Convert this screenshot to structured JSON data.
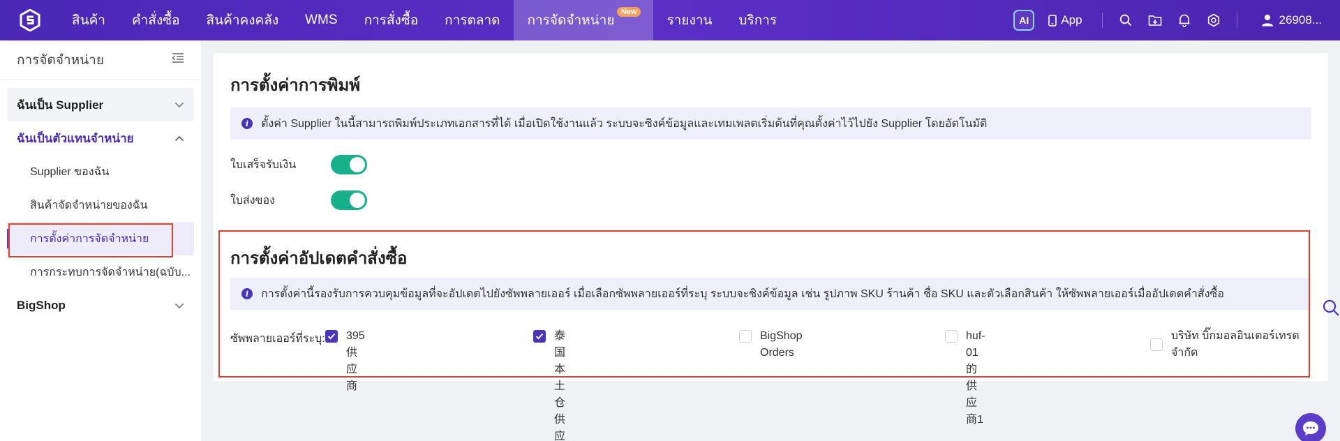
{
  "nav": {
    "items": [
      {
        "label": "สินค้า"
      },
      {
        "label": "คำสั่งซื้อ"
      },
      {
        "label": "สินค้าคงคลัง"
      },
      {
        "label": "WMS"
      },
      {
        "label": "การสั่งซื้อ"
      },
      {
        "label": "การตลาด"
      },
      {
        "label": "การจัดจำหน่าย",
        "badge": "New",
        "active": true
      },
      {
        "label": "รายงาน"
      },
      {
        "label": "บริการ"
      }
    ],
    "ai_label": "AI",
    "app_label": "App",
    "user_label": "26908..."
  },
  "sidebar": {
    "title": "การจัดจำหน่าย",
    "group1": "ฉันเป็น Supplier",
    "group2": "ฉันเป็นตัวแทนจำหน่าย",
    "items": [
      {
        "label": "Supplier ของฉัน"
      },
      {
        "label": "สินค้าจัดจำหน่ายของฉัน"
      },
      {
        "label": "การตั้งค่าการจัดจำหน่าย"
      },
      {
        "label": "การกระทบการจัดจำหน่าย(ฉบับ..."
      }
    ],
    "group3": "BigShop"
  },
  "print_settings": {
    "title": "การตั้งค่าการพิมพ์",
    "info": "ตั้งค่า Supplier ในนี้สามารถพิมพ์ประเภทเอกสารที่ได้ เมื่อเปิดใช้งานแล้ว ระบบจะซิงค์ข้อมูลและเทมเพลตเริ่มต้นที่คุณตั้งค่าไว้ไปยัง Supplier โดยอัตโนมัติ",
    "toggle1_label": "ใบเสร็จรับเงิน",
    "toggle2_label": "ใบส่งของ"
  },
  "order_update": {
    "title": "การตั้งค่าอัปเดตคำสั่งซื้อ",
    "info": "การตั้งค่านี้รองรับการควบคุมข้อมูลที่จะอัปเดตไปยังซัพพลายเออร์ เมื่อเลือกซัพพลายเออร์ที่ระบุ ระบบจะซิงค์ข้อมูล เช่น รูปภาพ SKU ร้านค้า ชื่อ SKU และตัวเลือกสินค้า ให้ซัพพลายเออร์เมื่ออัปเดตคำสั่งซื้อ",
    "supplier_label": "ซัพพลายเออร์ที่ระบุ:",
    "suppliers": [
      {
        "name": "395供应商",
        "checked": true
      },
      {
        "name": "泰国本土仓供应链",
        "checked": true
      },
      {
        "name": "BigShop Orders",
        "checked": false
      },
      {
        "name": "huf-01的供应商1",
        "checked": false
      },
      {
        "name": "บริษัท บิ๊กมอลอินเตอร์เทรด จำกัด",
        "checked": false
      }
    ]
  },
  "colors": {
    "nav": "#4b27b6",
    "accent": "#4a34b8",
    "toggle_on": "#17b08a",
    "highlight": "#d9432b"
  }
}
